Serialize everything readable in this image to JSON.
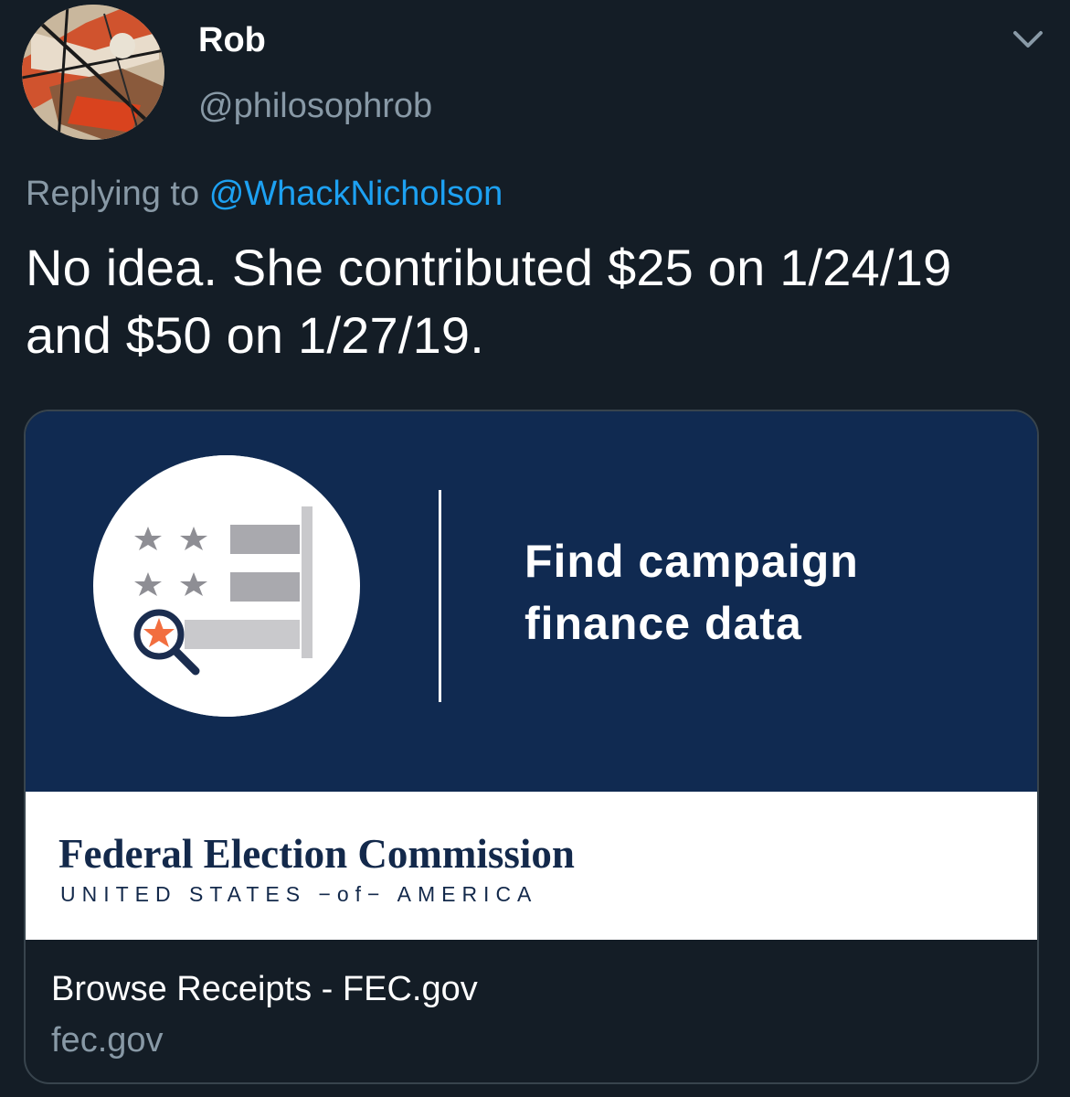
{
  "user": {
    "display_name": "Rob",
    "handle": "@philosophrob"
  },
  "reply": {
    "prefix": "Replying to",
    "mention": "@WhackNicholson"
  },
  "tweet": {
    "text": "No idea. She contributed $25 on 1/24/19 and $50 on 1/27/19."
  },
  "card": {
    "banner_title": "Find campaign finance data",
    "org_name": "Federal Election Commission",
    "org_subtitle": "UNITED STATES −of− AMERICA",
    "link_title": "Browse Receipts - FEC.gov",
    "link_domain": "fec.gov"
  },
  "icons": {
    "menu": "chevron-down-icon",
    "badge": "fec-data-search-icon"
  },
  "colors": {
    "background": "#141d26",
    "secondary_text": "#8899a6",
    "link": "#1da1f2",
    "card_banner": "#102a51",
    "fec_navy": "#13294b",
    "accent_orange": "#f26e3f"
  }
}
